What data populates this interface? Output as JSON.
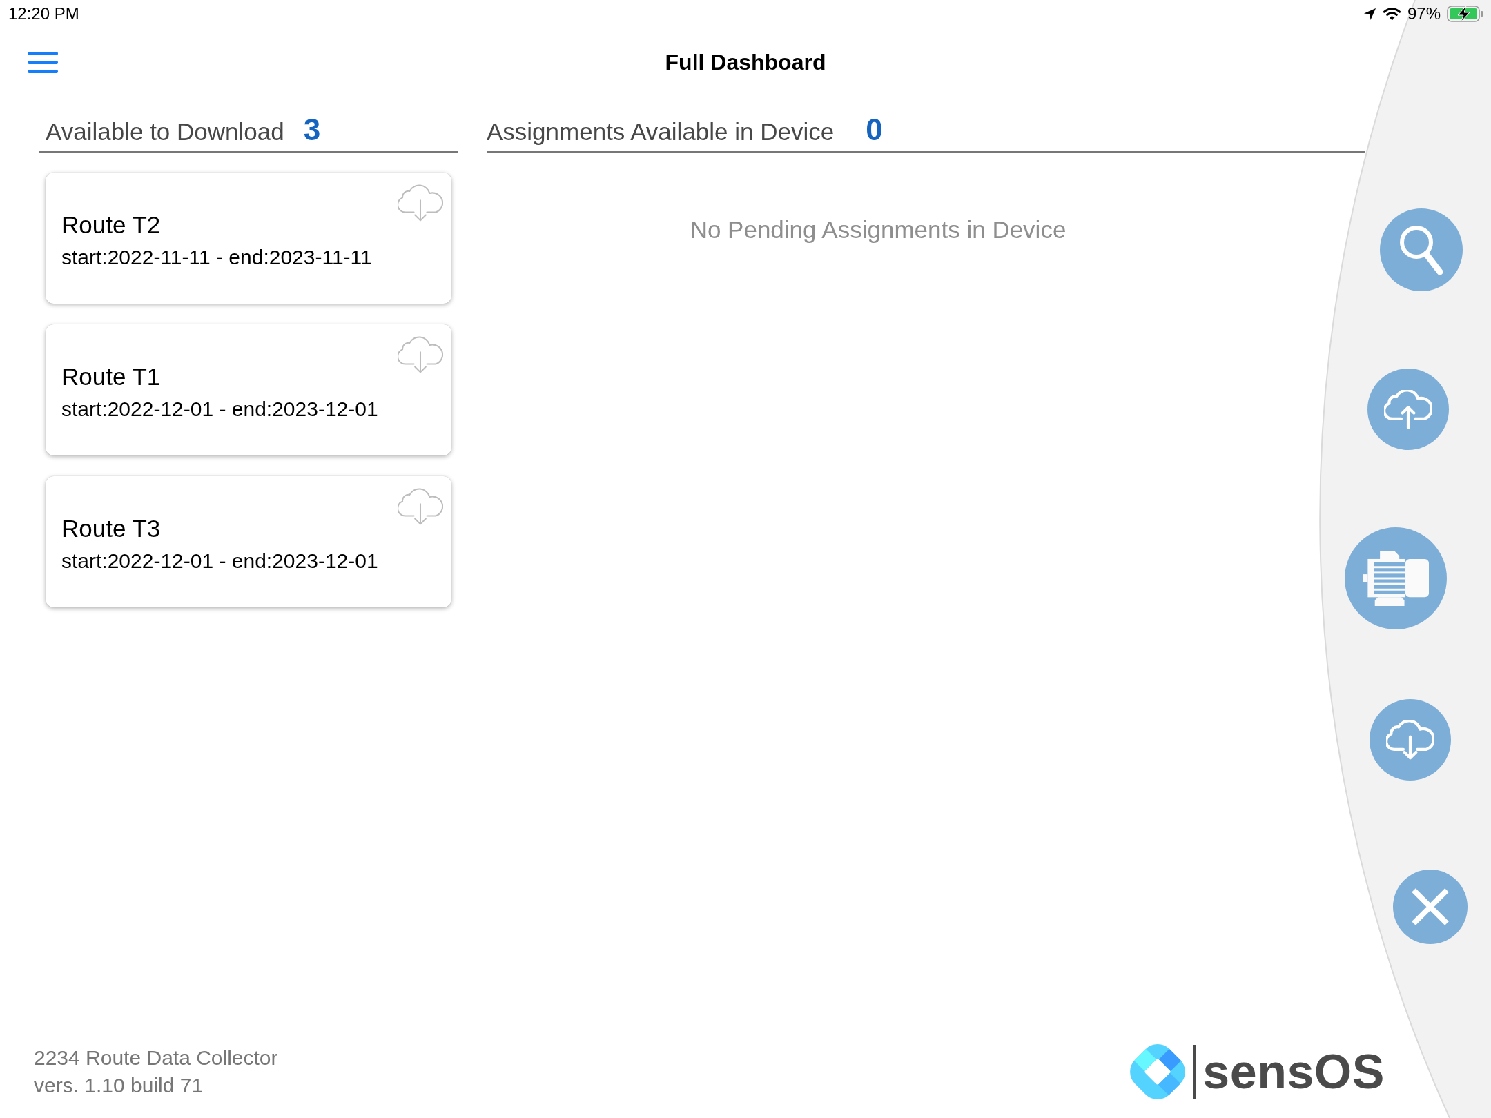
{
  "status_bar": {
    "time": "12:20 PM",
    "battery": "97%"
  },
  "header": {
    "title": "Full Dashboard"
  },
  "available_to_download": {
    "title": "Available to Download",
    "count": "3",
    "routes": [
      {
        "name": "Route T2",
        "dates": "start:2022-11-11 - end:2023-11-11"
      },
      {
        "name": "Route T1",
        "dates": "start:2022-12-01 - end:2023-12-01"
      },
      {
        "name": "Route T3",
        "dates": "start:2022-12-01 - end:2023-12-01"
      }
    ]
  },
  "available_in_device": {
    "title": "Assignments Available in Device",
    "count": "0",
    "empty_message": "No Pending Assignments in Device"
  },
  "footer": {
    "app_name": "2234 Route Data Collector",
    "version": "vers. 1.10 build 71"
  },
  "logo": {
    "text": "sensOS"
  }
}
